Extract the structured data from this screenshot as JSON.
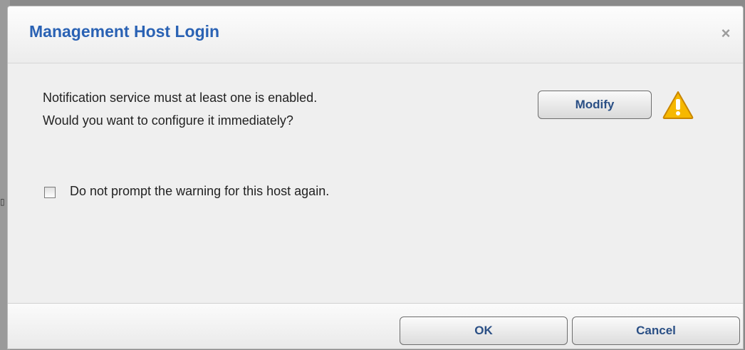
{
  "dialog": {
    "title": "Management Host Login",
    "close_icon": "×",
    "message_line1": "Notification service must at least one is enabled.",
    "message_line2": "Would you want to configure it immediately?",
    "modify_label": "Modify",
    "checkbox_label": "Do not prompt the warning for this host again.",
    "checkbox_checked": false,
    "ok_label": "OK",
    "cancel_label": "Cancel"
  },
  "colors": {
    "title": "#2a62b4",
    "button_text": "#2a4f85",
    "warning_fill": "#f6b800"
  },
  "icons": {
    "close": "close-icon",
    "warning": "warning-icon"
  }
}
